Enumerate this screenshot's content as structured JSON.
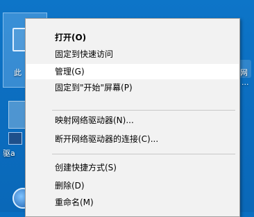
{
  "desktop": {
    "labels": {
      "this_pc_partial": "此",
      "network_partial": "网",
      "network_sub_partial": "...",
      "driver_partial": "驱a"
    }
  },
  "context_menu": {
    "items": [
      {
        "label": "打开(O)"
      },
      {
        "label": "固定到快速访问"
      },
      {
        "label": "管理(G)"
      },
      {
        "label": "固定到\"开始\"屏幕(P)"
      },
      {
        "label": "映射网络驱动器(N)..."
      },
      {
        "label": "断开网络驱动器的连接(C)..."
      },
      {
        "label": "创建快捷方式(S)"
      },
      {
        "label": "删除(D)"
      },
      {
        "label": "重命名(M)"
      }
    ]
  }
}
